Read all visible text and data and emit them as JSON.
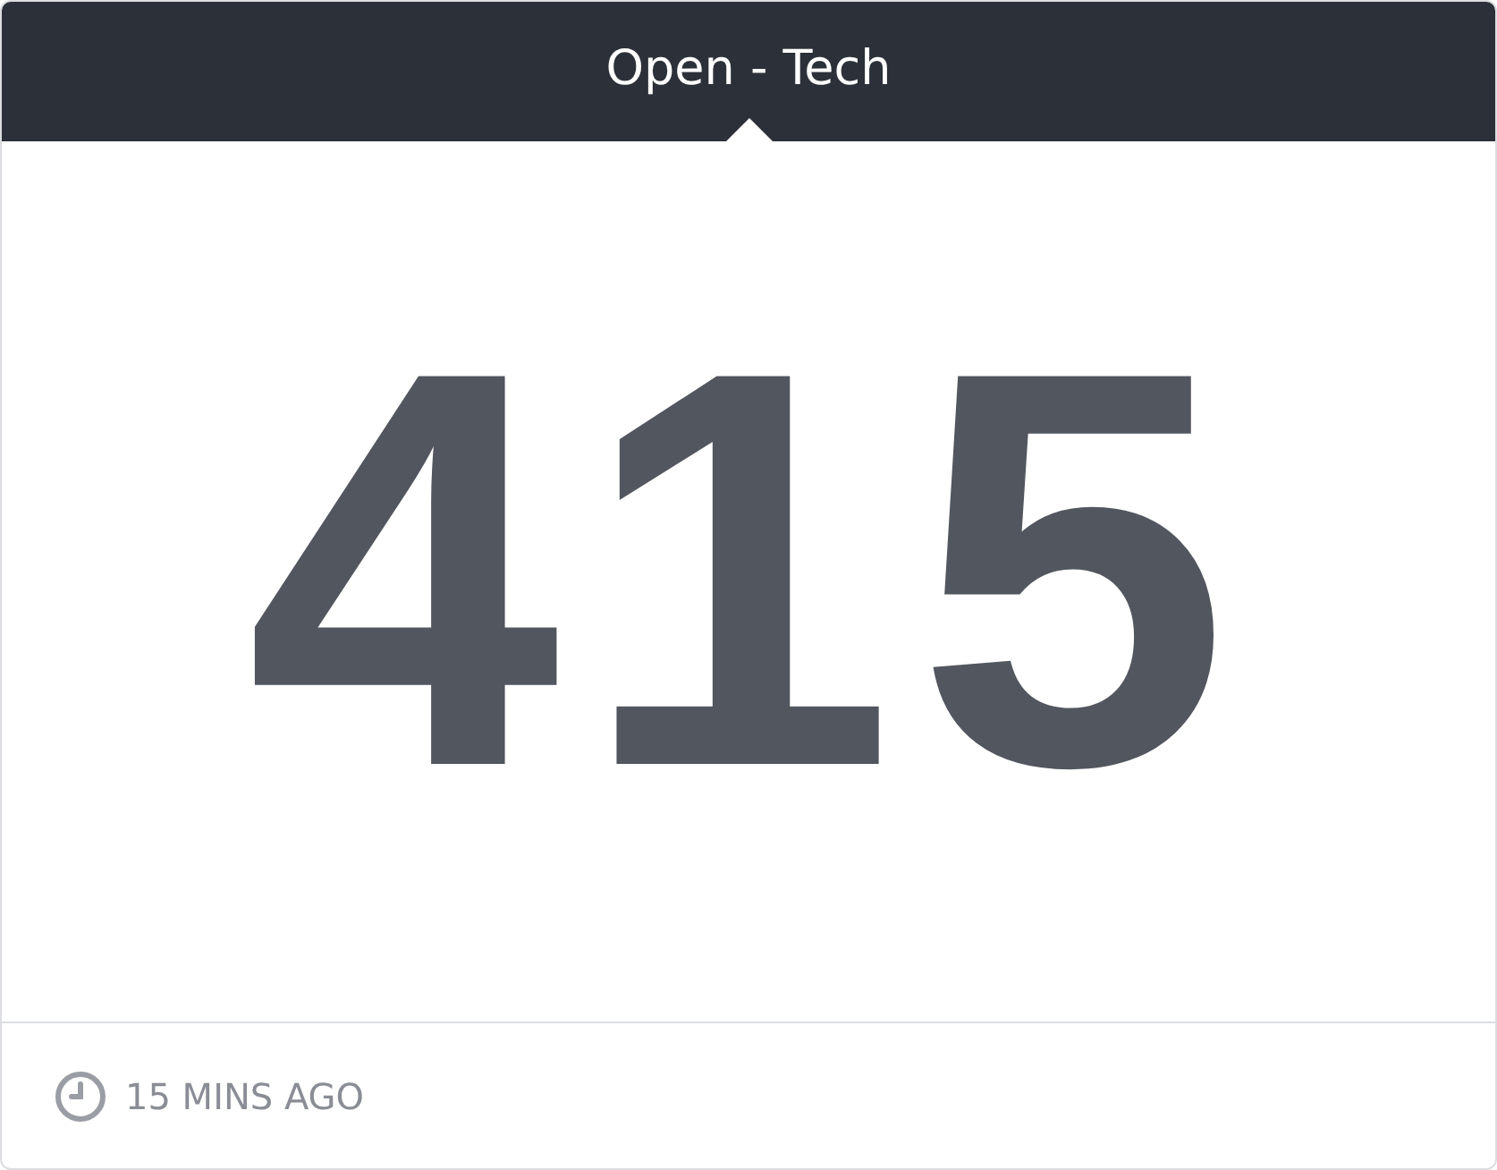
{
  "header": {
    "title": "Open - Tech"
  },
  "metric": {
    "value": "415"
  },
  "footer": {
    "updated": "15 MINS AGO"
  }
}
